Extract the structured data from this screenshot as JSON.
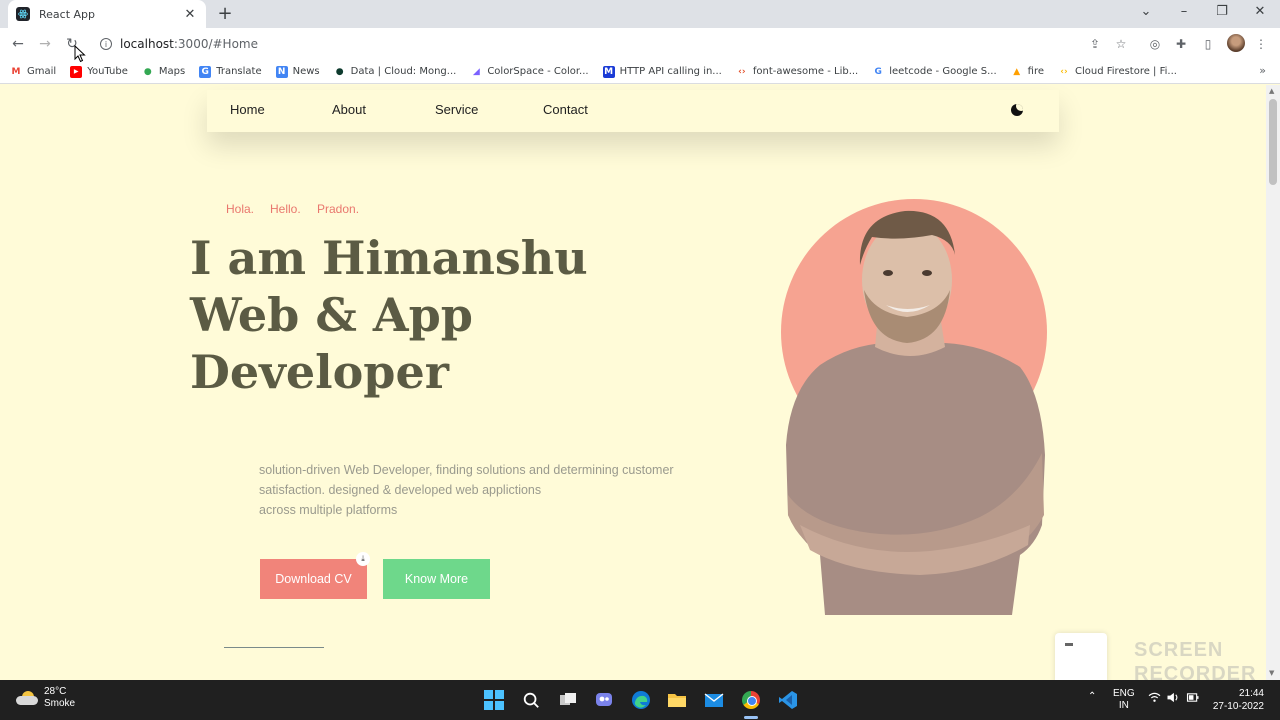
{
  "browser": {
    "tab_title": "React App",
    "new_tab": "+",
    "close": "✕",
    "url_host": "localhost",
    "url_path": ":3000/#Home",
    "bookmarks": [
      {
        "label": "Gmail",
        "icon": "gmail-icon",
        "color": "#ea4335",
        "glyph": "M"
      },
      {
        "label": "YouTube",
        "icon": "youtube-icon",
        "color": "#ff0000",
        "glyph": "▶"
      },
      {
        "label": "Maps",
        "icon": "maps-icon",
        "color": "#34a853",
        "glyph": "●"
      },
      {
        "label": "Translate",
        "icon": "translate-icon",
        "color": "#4285f4",
        "glyph": "G"
      },
      {
        "label": "News",
        "icon": "news-icon",
        "color": "#4285f4",
        "glyph": "N"
      },
      {
        "label": "Data | Cloud: Mong...",
        "icon": "mongodb-icon",
        "color": "#0e3b2e",
        "glyph": "●"
      },
      {
        "label": "ColorSpace - Color...",
        "icon": "colorspace-icon",
        "color": "#7b61ff",
        "glyph": "◢"
      },
      {
        "label": "HTTP API calling in...",
        "icon": "http-api-icon",
        "color": "#1a3bd6",
        "glyph": "M"
      },
      {
        "label": "font-awesome - Lib...",
        "icon": "code-icon",
        "color": "#e34c26",
        "glyph": "‹›"
      },
      {
        "label": "leetcode - Google S...",
        "icon": "google-icon",
        "color": "#4285f4",
        "glyph": "G"
      },
      {
        "label": "fire",
        "icon": "firebase-icon",
        "color": "#ffa000",
        "glyph": "▲"
      },
      {
        "label": "Cloud Firestore | Fi...",
        "icon": "firestore-icon",
        "color": "#fbbc05",
        "glyph": "‹›"
      }
    ],
    "more": "»"
  },
  "site": {
    "nav": [
      "Home",
      "About",
      "Service",
      "Contact"
    ],
    "greetings": [
      "Hola.",
      "Hello.",
      "Pradon."
    ],
    "headline": [
      "I am Himanshu",
      "Web & App",
      "Developer"
    ],
    "intro": [
      "solution-driven Web Developer, finding solutions and determining customer",
      "satisfaction. designed & developed web applictions",
      "across multiple platforms"
    ],
    "download_cv": "Download CV",
    "know_more": "Know More",
    "download_glyph": "⤓",
    "colors": {
      "background": "#fffbd8",
      "accent": "#f1847a",
      "secondary": "#6ed88b",
      "heading": "#5b5b44"
    }
  },
  "overlay": {
    "watermark": [
      "SCREEN",
      "RECORDER"
    ]
  },
  "taskbar": {
    "temperature": "28°C",
    "weather": "Smoke",
    "language": [
      "ENG",
      "IN"
    ],
    "time": "21:44",
    "date": "27-10-2022"
  }
}
